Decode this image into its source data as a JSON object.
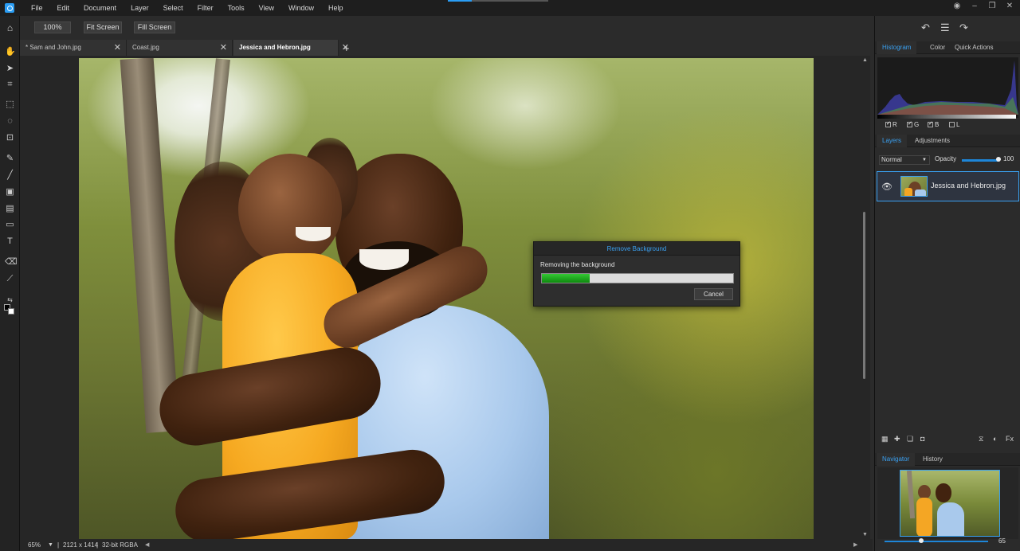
{
  "menu": [
    "File",
    "Edit",
    "Document",
    "Layer",
    "Select",
    "Filter",
    "Tools",
    "View",
    "Window",
    "Help"
  ],
  "options_bar": {
    "zoom": "100%",
    "fit_screen": "Fit Screen",
    "fill_screen": "Fill Screen"
  },
  "tabs": [
    {
      "label": "* Sam and John.jpg"
    },
    {
      "label": "Coast.jpg"
    },
    {
      "label": "Jessica and Hebron.jpg"
    }
  ],
  "status": {
    "zoom": "65%",
    "dimensions": "2121 x 1414",
    "color_mode": "32-bit RGBA"
  },
  "dialog": {
    "title": "Remove Background",
    "message": "Removing the background",
    "progress": 0.25,
    "cancel": "Cancel"
  },
  "panel": {
    "top_tabs": [
      "Histogram",
      "Color",
      "Quick Actions"
    ],
    "channels": [
      {
        "label": "R",
        "checked": true
      },
      {
        "label": "G",
        "checked": true
      },
      {
        "label": "B",
        "checked": true
      },
      {
        "label": "L",
        "checked": false
      }
    ],
    "mid_tabs": [
      "Layers",
      "Adjustments"
    ],
    "blend_mode": "Normal",
    "opacity_label": "Opacity",
    "opacity_value": "100",
    "layer_name": "Jessica and Hebron.jpg",
    "bottom_tabs": [
      "Navigator",
      "History"
    ],
    "navigator_value": "65"
  },
  "colors": {
    "accent": "#3aa0f0",
    "progress": "#1a9e1a"
  }
}
